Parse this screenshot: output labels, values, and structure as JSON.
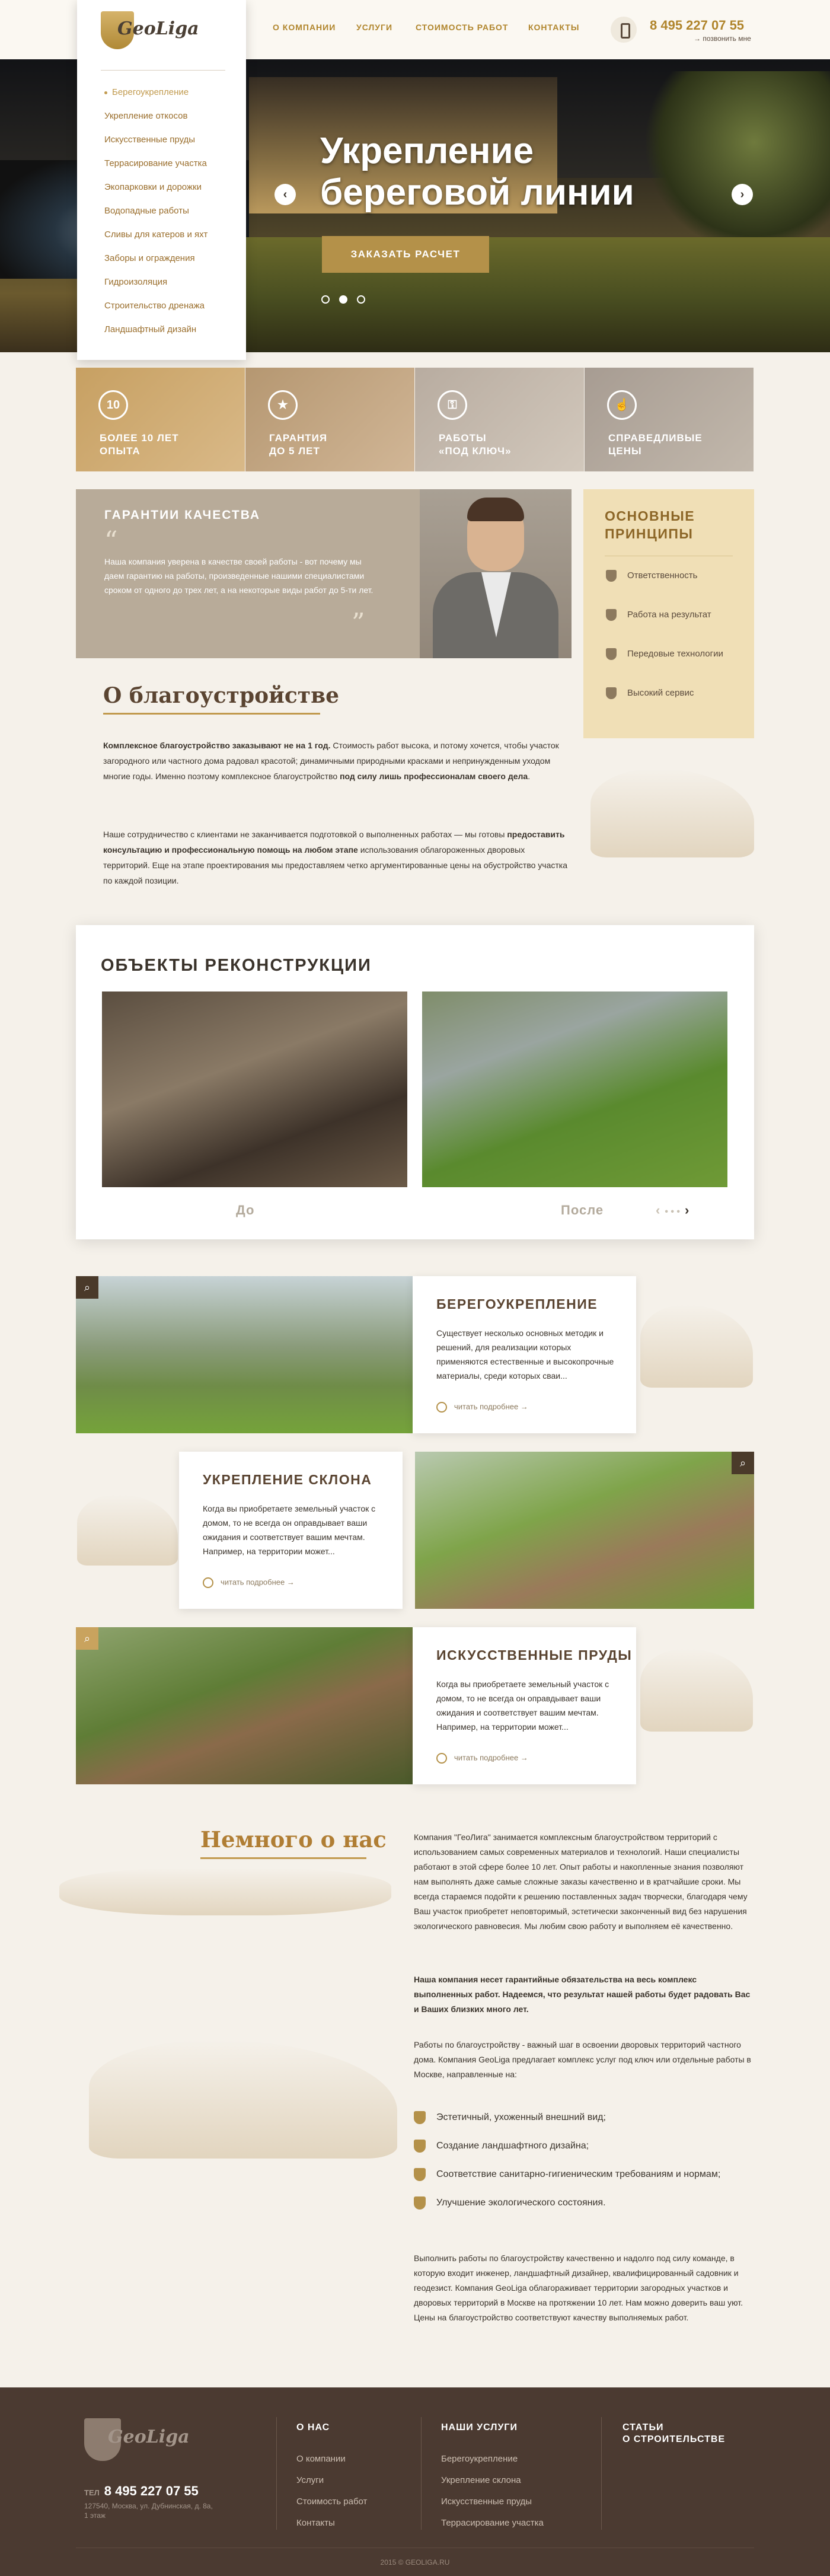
{
  "header": {
    "nav": [
      "О компании",
      "Услуги",
      "Стоимость работ",
      "Контакты"
    ],
    "phone": "8 495 227 07 55",
    "callme": "позвонить мне"
  },
  "logo": {
    "text": "GeoLiga"
  },
  "dropdown": {
    "items": [
      "Берегоукрепление",
      "Укрепление откосов",
      "Искусственные пруды",
      "Террасирование участка",
      "Экопарковки и дорожки",
      "Водопадные работы",
      "Сливы для катеров и яхт",
      "Заборы и ограждения",
      "Гидроизоляция",
      "Строительство дренажа",
      "Ландшафтный дизайн"
    ]
  },
  "hero": {
    "title_line1": "Укрепление",
    "title_line2": "береговой линии",
    "button": "Заказать расчет",
    "prev": "‹",
    "next": "›"
  },
  "features": [
    {
      "icon": "10",
      "line1": "Более 10 лет",
      "line2": "опыта"
    },
    {
      "icon": "★",
      "line1": "Гарантия",
      "line2": "до 5 лет"
    },
    {
      "icon": "⚿",
      "line1": "Работы",
      "line2": "«под ключ»"
    },
    {
      "icon": "☝",
      "line1": "Справедливые",
      "line2": "цены"
    }
  ],
  "quality": {
    "title": "Гарантии качества",
    "text": "Наша компания уверена в качестве своей работы - вот почему мы даем гарантию на работы, произведенные нашими специалистами сроком от одного до трех лет, а на некоторые виды работ до 5-ти лет."
  },
  "principles": {
    "title_line1": "Основные",
    "title_line2": "принципы",
    "items": [
      "Ответственность",
      "Работа на результат",
      "Передовые технологии",
      "Высокий сервис"
    ]
  },
  "about": {
    "title": "О благоустройстве",
    "p1_bold": "Комплексное благоустройство заказывают не на 1 год.",
    "p1_rest": " Стоимость работ высока, и потому хочется, чтобы участок загородного или частного дома радовал красотой; динамичными природными красками и непринужденным уходом многие годы. Именно поэтому комплексное благоустройство ",
    "p1_bold2": "под силу лишь профессионалам своего дела",
    "p1_end": ".",
    "p2_start": "Наше сотрудничество с клиентами не заканчивается подготовкой о выполненных работах — мы готовы ",
    "p2_bold": "предоставить консультацию и профессиональную помощь на любом этапе",
    "p2_rest": " использования облагороженных дворовых территорий. Еще на этапе проектирования мы предоставляем четко аргументированные цены на обустройство участка по каждой позиции."
  },
  "objects": {
    "title": "Объекты реконструкции",
    "before": "До",
    "after": "После",
    "prev": "‹",
    "next": "›"
  },
  "cards": [
    {
      "title": "Берегоукрепление",
      "text": "Существует несколько основных методик и решений, для реализации которых применяются естественные и высокопрочные материалы, среди которых сваи...",
      "more": "читать подробнее →"
    },
    {
      "title": "Укрепление склона",
      "text": "Когда вы приобретаете земельный участок с домом, то не всегда он оправдывает ваши ожидания и соответствует вашим мечтам. Например, на территории может...",
      "more": "читать подробнее →"
    },
    {
      "title": "Искусственные пруды",
      "text": "Когда вы приобретаете земельный участок с домом, то не всегда он оправдывает ваши ожидания и соответствует вашим мечтам. Например, на территории может...",
      "more": "читать подробнее →"
    }
  ],
  "about_us": {
    "title": "Немного о нас",
    "p1": "Компания \"ГеоЛига\" занимается комплексным благоустройством территорий с использованием самых современных материалов и технологий. Наши специалисты работают в этой сфере более 10 лет. Опыт работы и накопленные знания позволяют нам выполнять даже самые сложные заказы качественно и в кратчайшие сроки. Мы всегда стараемся подойти к решению поставленных задач творчески, благодаря чему Ваш участок приобретет неповторимый, эстетически законченный вид без нарушения экологического равновесия. Мы любим свою работу и выполняем её качественно.",
    "p2": "Наша компания несет гарантийные обязательства на весь комплекс выполненных работ. Надеемся, что результат нашей работы будет радовать Вас и Ваших близких много лет.",
    "p3": "Работы по благоустройству - важный шаг в освоении дворовых территорий частного дома. Компания GeoLiga предлагает комплекс услуг под ключ или отдельные работы в Москве, направленные на:",
    "checks": [
      "Эстетичный, ухоженный внешний вид;",
      "Создание ландшафтного дизайна;",
      "Соответствие санитарно-гигиеническим требованиям и нормам;",
      "Улучшение экологического состояния."
    ],
    "p4": "Выполнить работы по благоустройству качественно и надолго под силу команде, в которую входит инженер, ландшафтный дизайнер, квалифицированный садовник и геодезист. Компания GeoLiga облагораживает территории загородных участков и дворовых территорий в Москве на протяжении 10 лет. Нам можно доверить ваш уют. Цены на благоустройство соответствуют качеству выполняемых работ."
  },
  "footer": {
    "tel_label": "ТЕЛ",
    "tel": "8 495 227 07 55",
    "address": "127540, Москва, ул. Дубнинская, д. 8а, 1 этаж",
    "col1_title": "О нас",
    "col1_links": [
      "О компании",
      "Услуги",
      "Стоимость работ",
      "Контакты"
    ],
    "col2_title": "Наши услуги",
    "col2_links": [
      "Берегоукрепление",
      "Укрепление склона",
      "Искусственные пруды",
      "Террасирование участка"
    ],
    "col3_title_line1": "Статьи",
    "col3_title_line2": "о строительстве",
    "copyright": "2015 © GEOLIGA.RU"
  },
  "colors": {
    "accent": "#b49149",
    "brown": "#4b3a31",
    "principles_bg": "#f0dfb6"
  }
}
